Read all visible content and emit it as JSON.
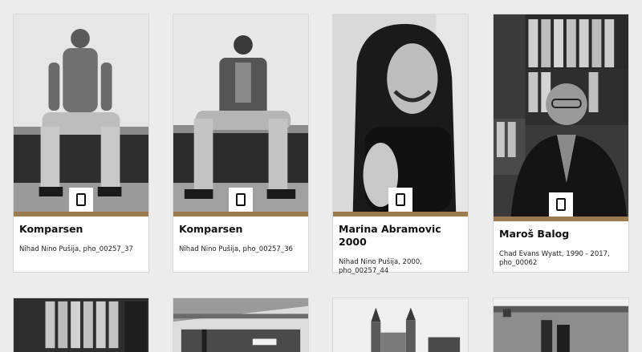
{
  "cards": [
    {
      "title": "Komparsen",
      "meta": "Nihad Nino Pušija, pho_00257_37",
      "frame_icon": "frame-icon"
    },
    {
      "title": "Komparsen",
      "meta": "Nihad Nino Pušija, pho_00257_36",
      "frame_icon": "frame-icon"
    },
    {
      "title": "Marina Abramovic 2000",
      "meta": "Nihad Nino Pušija, 2000, pho_00257_44",
      "frame_icon": "frame-icon"
    },
    {
      "title": "Maroš Balog",
      "meta": "Chad Evans Wyatt, 1990 - 2017, pho_00062",
      "frame_icon": "frame-icon"
    }
  ],
  "colors": {
    "accent_bar": "#9c7b50",
    "page_bg": "#ececec"
  }
}
